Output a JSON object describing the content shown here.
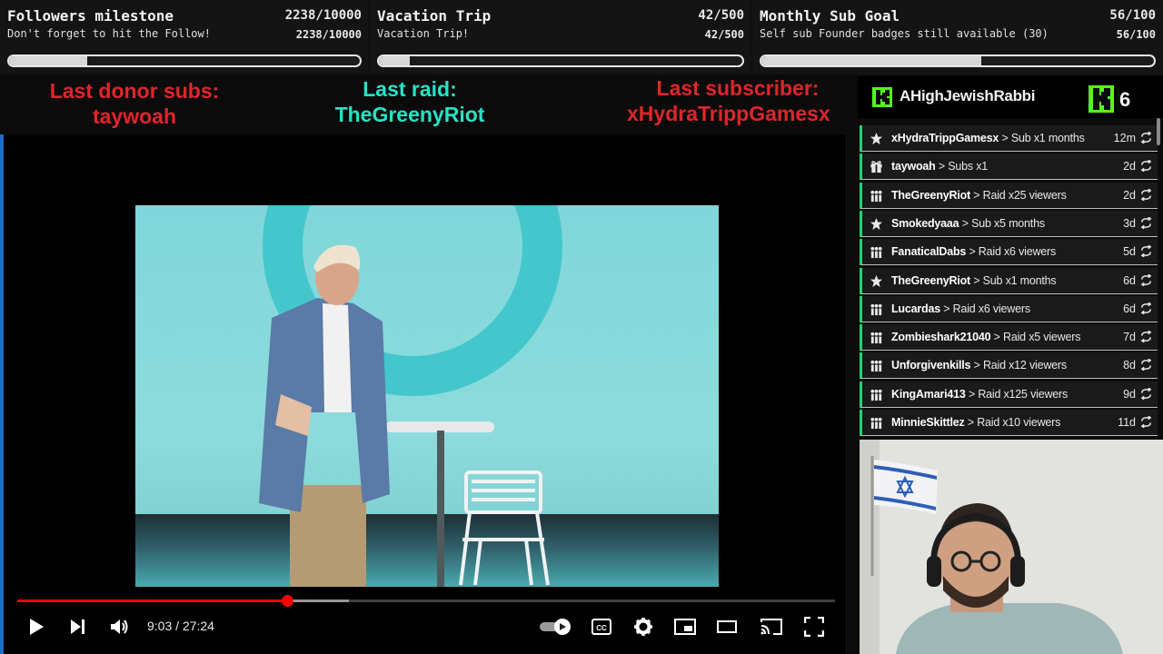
{
  "goals": [
    {
      "title": "Followers milestone",
      "count": "2238/10000",
      "subtitle": "Don't forget to hit the Follow!",
      "subcount": "2238/10000",
      "progress": 0.2238
    },
    {
      "title": "Vacation Trip",
      "count": "42/500",
      "subtitle": "Vacation Trip!",
      "subcount": "42/500",
      "progress": 0.084
    },
    {
      "title": "Monthly Sub Goal",
      "count": "56/100",
      "subtitle": "Self sub Founder badges still available (30)",
      "subcount": "56/100",
      "progress": 0.56
    }
  ],
  "alerts": {
    "donor_label": "Last donor subs:",
    "donor_name": "taywoah",
    "raid_label": "Last raid:",
    "raid_name": "TheGreenyRiot",
    "sub_label": "Last subscriber:",
    "sub_name": "xHydraTrippGamesx"
  },
  "player": {
    "time": "9:03 / 27:24",
    "played_fraction": 0.33,
    "buffered_fraction": 0.405
  },
  "kick": {
    "username": "AHighJewishRabbi",
    "viewer_count": "6",
    "brand_color": "#53fc18"
  },
  "events": [
    {
      "icon": "star-icon",
      "name": "xHydraTrippGamesx",
      "detail": "> Sub x1 months",
      "age": "12m"
    },
    {
      "icon": "gift-icon",
      "name": "taywoah",
      "detail": "> Subs x1",
      "age": "2d"
    },
    {
      "icon": "raid-icon",
      "name": "TheGreenyRiot",
      "detail": "> Raid x25 viewers",
      "age": "2d"
    },
    {
      "icon": "star-icon",
      "name": "Smokedyaaa",
      "detail": "> Sub x5 months",
      "age": "3d"
    },
    {
      "icon": "raid-icon",
      "name": "FanaticalDabs",
      "detail": "> Raid x6 viewers",
      "age": "5d"
    },
    {
      "icon": "star-icon",
      "name": "TheGreenyRiot",
      "detail": "> Sub x1 months",
      "age": "6d"
    },
    {
      "icon": "raid-icon",
      "name": "Lucardas",
      "detail": "> Raid x6 viewers",
      "age": "6d"
    },
    {
      "icon": "raid-icon",
      "name": "Zombieshark21040",
      "detail": "> Raid x5 viewers",
      "age": "7d"
    },
    {
      "icon": "raid-icon",
      "name": "Unforgivenkills",
      "detail": "> Raid x12 viewers",
      "age": "8d"
    },
    {
      "icon": "raid-icon",
      "name": "KingAmari413",
      "detail": "> Raid x125 viewers",
      "age": "9d"
    },
    {
      "icon": "raid-icon",
      "name": "MinnieSkittlez",
      "detail": "> Raid x10 viewers",
      "age": "11d"
    }
  ],
  "colors": {
    "alert_red": "#e0252b",
    "alert_cyan": "#27e3c6",
    "event_accent": "#24d26e",
    "progress_red": "#ff0000"
  }
}
